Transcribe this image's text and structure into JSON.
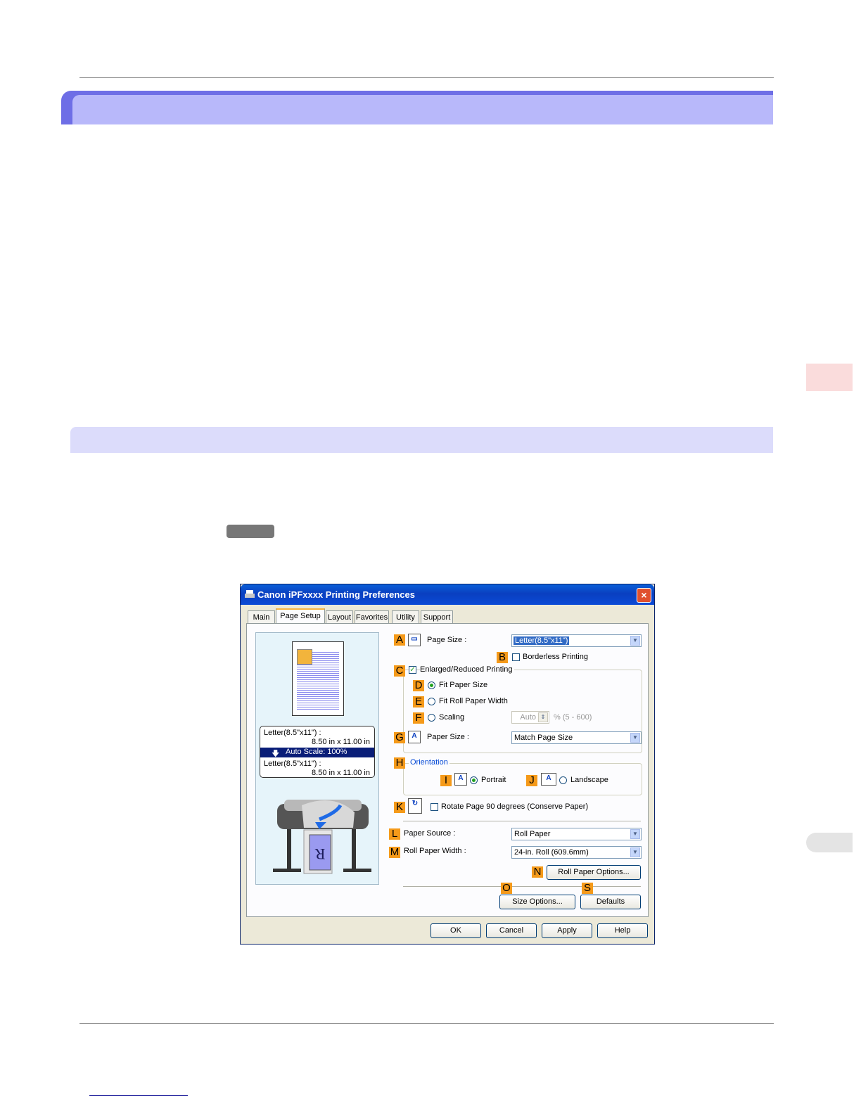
{
  "dialog": {
    "title": "Canon iPFxxxx Printing Preferences",
    "close_label": "×",
    "tabs": [
      "Main",
      "Page Setup",
      "Layout",
      "Favorites",
      "Utility",
      "Support"
    ],
    "active_tab": "Page Setup",
    "preview": {
      "line1": "Letter(8.5\"x11\") :",
      "line2": "8.50 in x 11.00 in",
      "scale_label": "Auto Scale: 100%",
      "line3": "Letter(8.5\"x11\") :",
      "line4": "8.50 in x 11.00 in",
      "printer_letter": "R"
    },
    "callouts": {
      "A": "A",
      "B": "B",
      "C": "C",
      "D": "D",
      "E": "E",
      "F": "F",
      "G": "G",
      "H": "H",
      "I": "I",
      "J": "J",
      "K": "K",
      "L": "L",
      "M": "M",
      "N": "N",
      "O": "O",
      "S": "S"
    },
    "page_size_label": "Page Size :",
    "page_size_value": "Letter(8.5\"x11\")",
    "borderless_label": "Borderless Printing",
    "enlarged_label": "Enlarged/Reduced Printing",
    "fit_paper_label": "Fit Paper Size",
    "fit_roll_label": "Fit Roll Paper Width",
    "scaling_label": "Scaling",
    "scaling_value": "Auto",
    "scaling_range": "% (5 - 600)",
    "paper_size_label": "Paper Size :",
    "paper_size_value": "Match Page Size",
    "orientation_label": "Orientation",
    "portrait_label": "Portrait",
    "landscape_label": "Landscape",
    "icon_letter": "A",
    "rotate_label": "Rotate Page 90 degrees (Conserve Paper)",
    "paper_source_label": "Paper Source :",
    "paper_source_value": "Roll Paper",
    "roll_width_label": "Roll Paper Width :",
    "roll_width_value": "24-in. Roll (609.6mm)",
    "roll_options_button": "Roll Paper Options...",
    "size_options_button": "Size Options...",
    "defaults_button": "Defaults",
    "ok_button": "OK",
    "cancel_button": "Cancel",
    "apply_button": "Apply",
    "help_button": "Help"
  },
  "colors": {
    "header_dark": "#6e6ee6",
    "header_light": "#b8b8fa",
    "subheader": "#dcdcfb",
    "callout": "#f59a1a"
  }
}
